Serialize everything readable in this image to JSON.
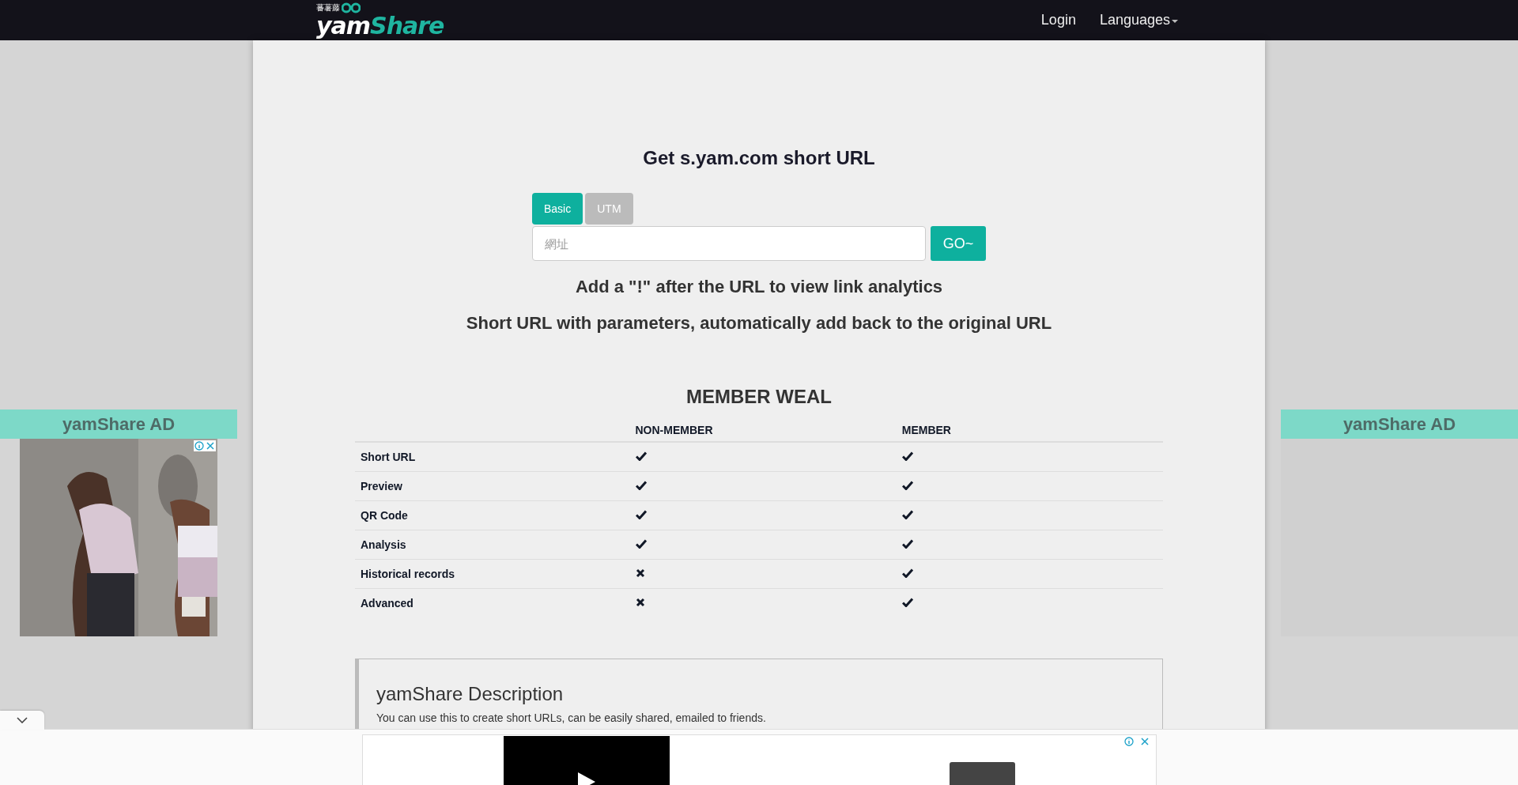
{
  "logo": {
    "tagline": "蕃薯藤",
    "word": [
      "yam",
      "Share"
    ]
  },
  "nav": {
    "login": "Login",
    "languages": "Languages"
  },
  "side_ads": [
    {
      "label": "yamShare AD",
      "kind": "picture"
    },
    {
      "label": "yamShare AD",
      "kind": "empty"
    }
  ],
  "title": "Get s.yam.com short URL",
  "tabs": [
    {
      "label": "Basic",
      "selected": true
    },
    {
      "label": "UTM",
      "selected": false
    }
  ],
  "url_field": {
    "placeholder": "網址"
  },
  "go_button": "GO~",
  "notes": [
    "Add a \"!\" after the URL to view link analytics",
    "Short URL with parameters, automatically add back to the original URL"
  ],
  "weal": {
    "title": "MEMBER WEAL",
    "columns": [
      "NON-MEMBER",
      "MEMBER"
    ],
    "rows": [
      {
        "feature": "Short URL",
        "non_member": true,
        "member": true
      },
      {
        "feature": "Preview",
        "non_member": true,
        "member": true
      },
      {
        "feature": "QR Code",
        "non_member": true,
        "member": true
      },
      {
        "feature": "Analysis",
        "non_member": true,
        "member": true
      },
      {
        "feature": "Historical records",
        "non_member": false,
        "member": true
      },
      {
        "feature": "Advanced",
        "non_member": false,
        "member": true
      }
    ]
  },
  "description": {
    "title": "yamShare Description",
    "text": "You can use this to create short URLs, can be easily shared, emailed to friends."
  }
}
